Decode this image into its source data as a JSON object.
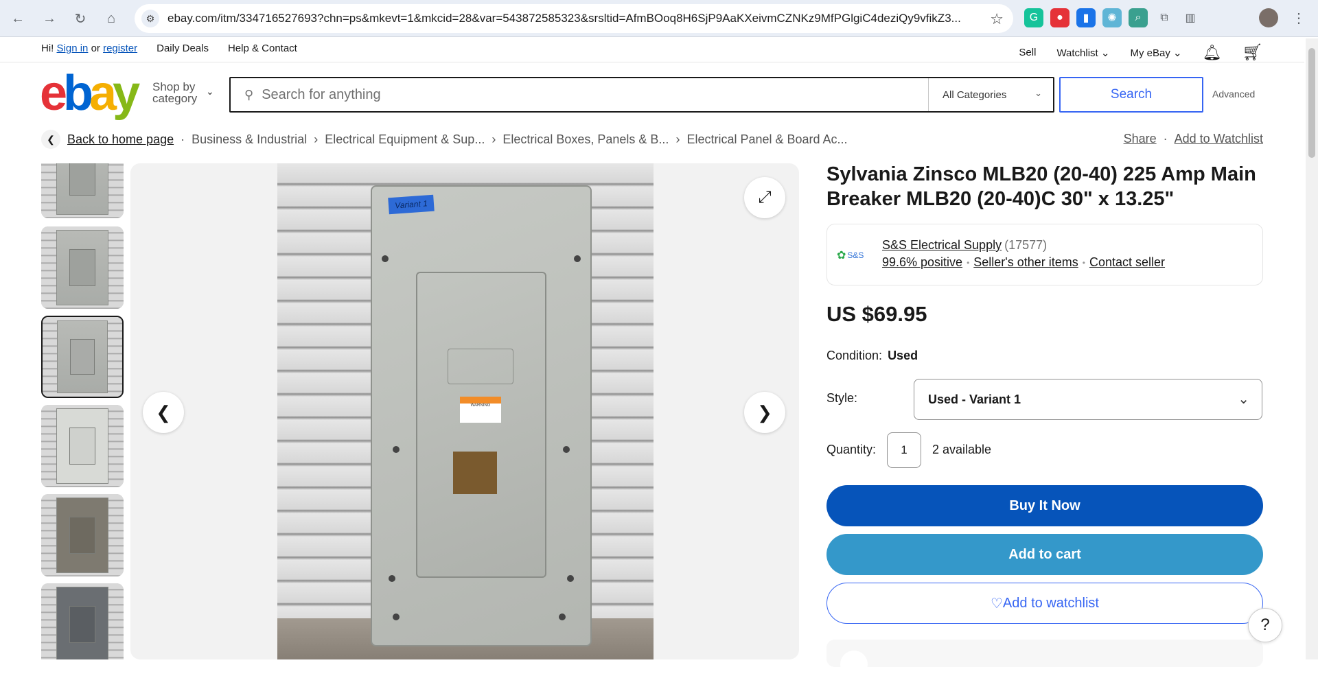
{
  "browser": {
    "url": "ebay.com/itm/334716527693?chn=ps&mkevt=1&mkcid=28&var=543872585323&srsltid=AfmBOoq8H6SjP9AaKXeivmCZNKz9MfPGlgiC4deziQy9vfikZ3...",
    "back_icon": "arrow-left-icon",
    "forward_icon": "arrow-right-icon",
    "reload_icon": "reload-icon",
    "home_icon": "home-icon",
    "extensions": [
      {
        "name": "grammarly-icon",
        "color": "#15c39a",
        "glyph": "G"
      },
      {
        "name": "pokeball-icon",
        "color": "#e53238",
        "glyph": "●"
      },
      {
        "name": "chart-extension-icon",
        "color": "#1a73e8",
        "glyph": "▮"
      },
      {
        "name": "atom-extension-icon",
        "color": "#5fb5d6",
        "glyph": "✺"
      },
      {
        "name": "search-extension-icon",
        "color": "#3aa08f",
        "glyph": "⌕"
      },
      {
        "name": "puzzle-icon",
        "color": "#5f6368",
        "glyph": "⧉"
      },
      {
        "name": "sidebar-icon",
        "color": "#5f6368",
        "glyph": "▥"
      }
    ]
  },
  "topbar": {
    "greeting": "Hi!",
    "sign_in": "Sign in",
    "or": "or",
    "register": "register",
    "daily_deals": "Daily Deals",
    "help": "Help & Contact",
    "sell": "Sell",
    "watchlist": "Watchlist",
    "my_ebay": "My eBay"
  },
  "header": {
    "logo": [
      "e",
      "b",
      "a",
      "y"
    ],
    "shop_by": "Shop by",
    "category": "category",
    "search_placeholder": "Search for anything",
    "category_select": "All Categories",
    "search_button": "Search",
    "advanced": "Advanced"
  },
  "breadcrumb": {
    "back": "Back to home page",
    "items": [
      "Business & Industrial",
      "Electrical Equipment & Sup...",
      "Electrical Boxes, Panels & B...",
      "Electrical Panel & Board Ac..."
    ],
    "share": "Share",
    "add_to_watchlist": "Add to Watchlist"
  },
  "gallery": {
    "tag_text": "Variant 1",
    "warning_text": "WARNING",
    "thumbnail_count": 6,
    "selected_thumbnail": 3
  },
  "item": {
    "title": "Sylvania Zinsco MLB20 (20-40) 225 Amp Main Breaker MLB20 (20-40)C 30\" x 13.25\"",
    "seller_logo": "S&S",
    "seller_name": "S&S Electrical Supply",
    "seller_count": "(17577)",
    "positive": "99.6% positive",
    "other_items": "Seller's other items",
    "contact": "Contact seller",
    "price": "US $69.95",
    "condition_label": "Condition:",
    "condition_value": "Used",
    "style_label": "Style:",
    "style_value": "Used - Variant 1",
    "quantity_label": "Quantity:",
    "quantity_value": "1",
    "available": "2 available",
    "buy_now": "Buy It Now",
    "add_to_cart": "Add to cart",
    "add_to_watchlist": "Add to watchlist",
    "help": "?"
  }
}
